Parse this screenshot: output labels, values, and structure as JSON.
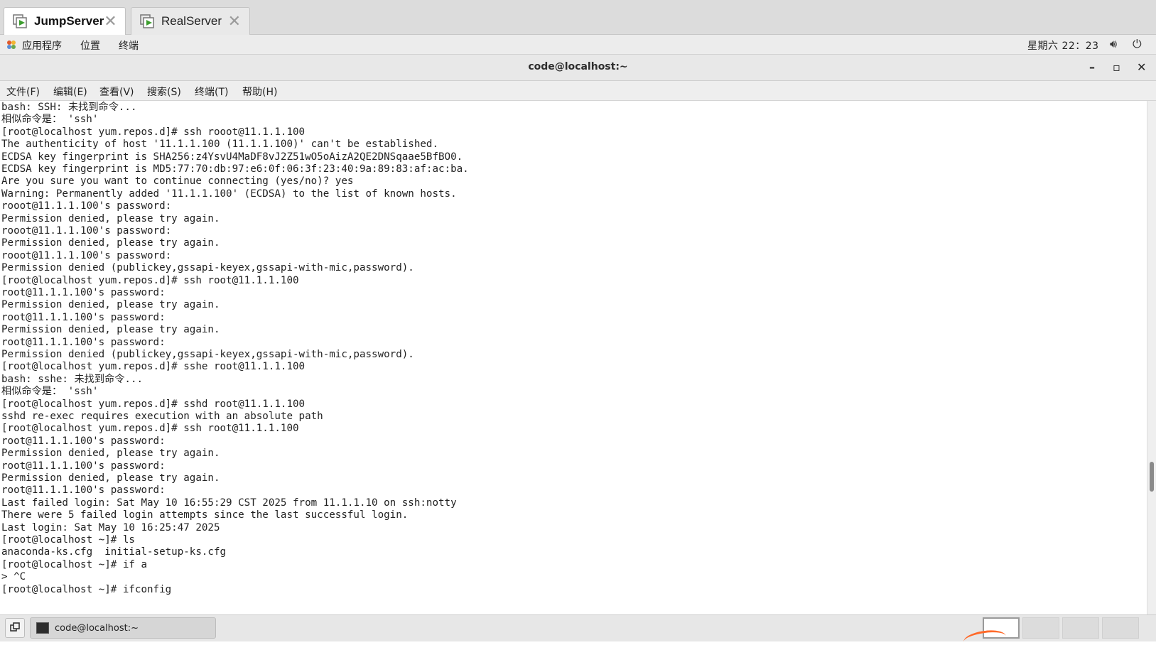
{
  "tabs": [
    {
      "label": "JumpServer",
      "icon": "vm-console-icon",
      "close": "✕"
    },
    {
      "label": "RealServer",
      "icon": "vm-console-icon",
      "close": "✕"
    }
  ],
  "panel": {
    "applications": "应用程序",
    "places": "位置",
    "terminal": "终端",
    "clock": "星期六 22：23",
    "icons": [
      "volume-icon",
      "power-icon"
    ]
  },
  "window": {
    "title": "code@localhost:~",
    "minimize": "–",
    "maximize": "▫",
    "close": "✕"
  },
  "menubar": {
    "file": "文件(F)",
    "edit": "编辑(E)",
    "view": "查看(V)",
    "search": "搜索(S)",
    "terminal": "终端(T)",
    "help": "帮助(H)"
  },
  "terminal": {
    "lines": [
      "bash: SSH: 未找到命令...",
      "相似命令是： 'ssh'",
      "[root@localhost yum.repos.d]# ssh rooot@11.1.1.100",
      "The authenticity of host '11.1.1.100 (11.1.1.100)' can't be established.",
      "ECDSA key fingerprint is SHA256:z4YsvU4MaDF8vJ2Z51wO5oAizA2QE2DNSqaae5BfBO0.",
      "ECDSA key fingerprint is MD5:77:70:db:97:e6:0f:06:3f:23:40:9a:89:83:af:ac:ba.",
      "Are you sure you want to continue connecting (yes/no)? yes",
      "Warning: Permanently added '11.1.1.100' (ECDSA) to the list of known hosts.",
      "rooot@11.1.1.100's password:",
      "Permission denied, please try again.",
      "rooot@11.1.1.100's password:",
      "Permission denied, please try again.",
      "rooot@11.1.1.100's password:",
      "Permission denied (publickey,gssapi-keyex,gssapi-with-mic,password).",
      "[root@localhost yum.repos.d]# ssh root@11.1.1.100",
      "root@11.1.1.100's password:",
      "Permission denied, please try again.",
      "root@11.1.1.100's password:",
      "Permission denied, please try again.",
      "root@11.1.1.100's password:",
      "Permission denied (publickey,gssapi-keyex,gssapi-with-mic,password).",
      "[root@localhost yum.repos.d]# sshe root@11.1.1.100",
      "bash: sshe: 未找到命令...",
      "相似命令是： 'ssh'",
      "[root@localhost yum.repos.d]# sshd root@11.1.1.100",
      "sshd re-exec requires execution with an absolute path",
      "[root@localhost yum.repos.d]# ssh root@11.1.1.100",
      "root@11.1.1.100's password:",
      "Permission denied, please try again.",
      "root@11.1.1.100's password:",
      "Permission denied, please try again.",
      "root@11.1.1.100's password:",
      "Last failed login: Sat May 10 16:55:29 CST 2025 from 11.1.1.10 on ssh:notty",
      "There were 5 failed login attempts since the last successful login.",
      "Last login: Sat May 10 16:25:47 2025",
      "[root@localhost ~]# ls",
      "anaconda-ks.cfg  initial-setup-ks.cfg",
      "[root@localhost ~]# if a",
      "> ^C",
      "[root@localhost ~]# ifconfig"
    ]
  },
  "taskbar": {
    "window_label": "code@localhost:~",
    "workspaces": 4,
    "active_workspace": 1
  },
  "colors": {
    "tab_icon_green": "#3d9e2f",
    "accent_orange": "#ff6a2a"
  }
}
